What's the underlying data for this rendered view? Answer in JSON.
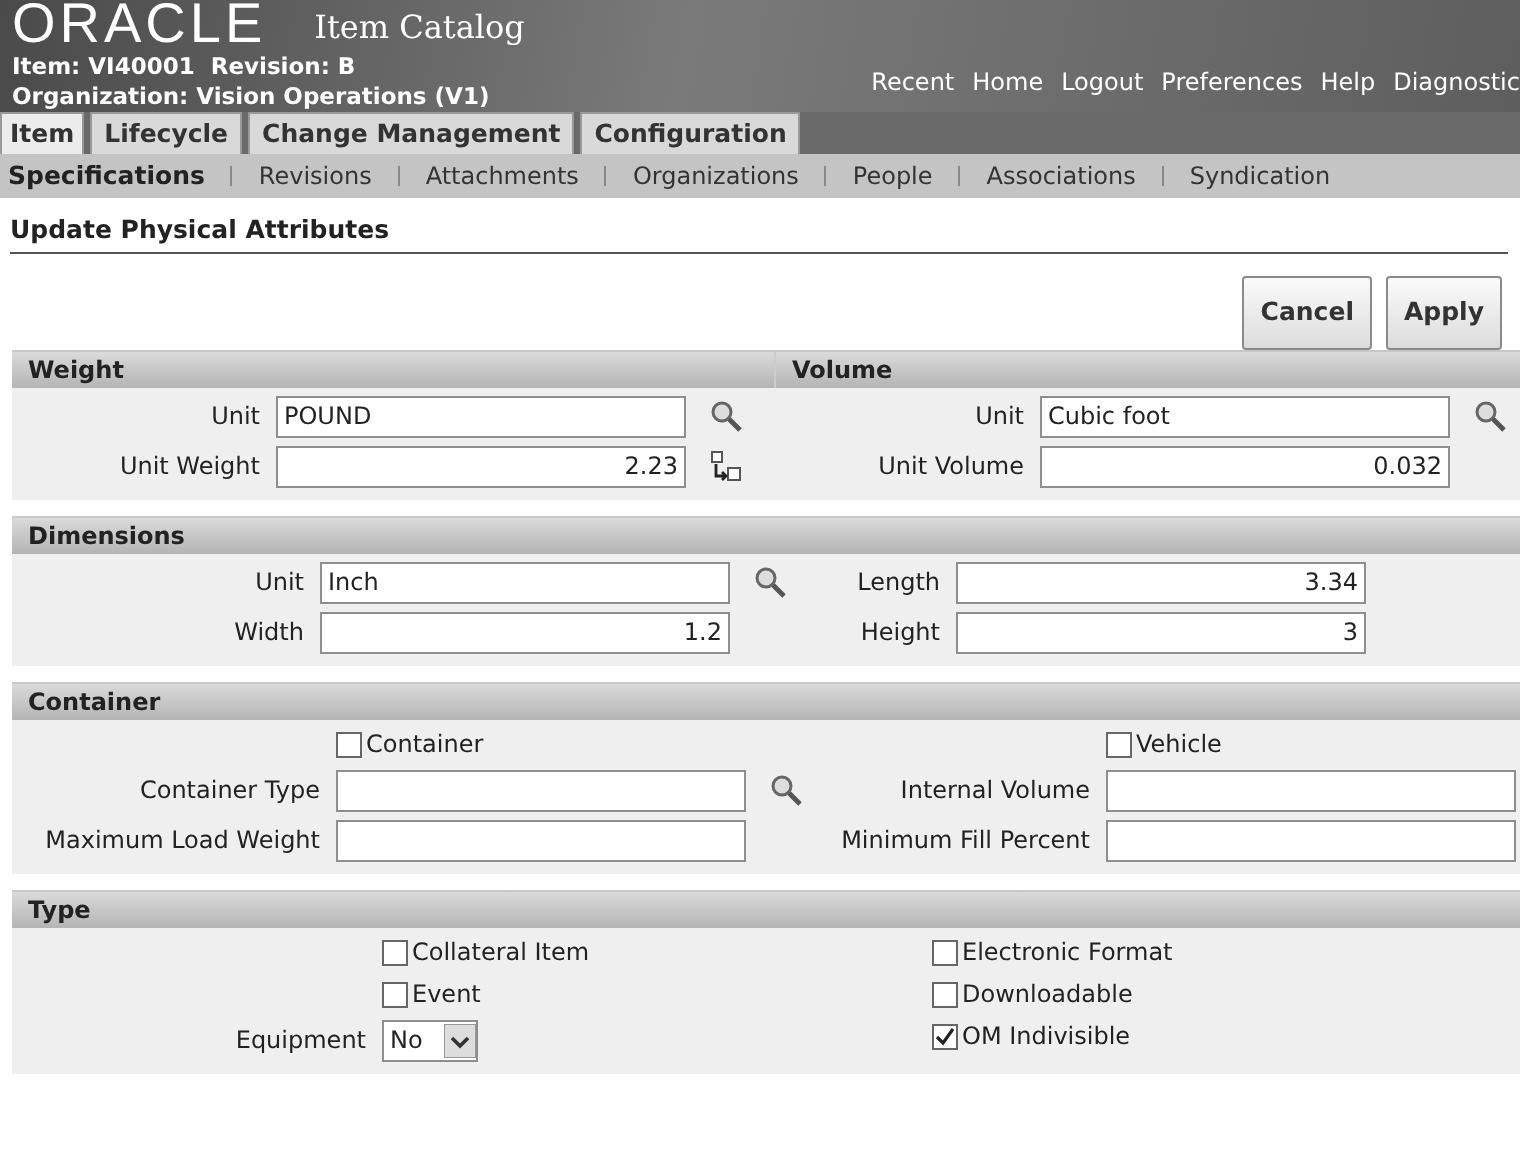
{
  "header": {
    "logo": "ORACLE",
    "app_title": "Item Catalog",
    "item_line": "Item: VI40001  Revision: B",
    "organization_line": "Organization: Vision Operations (V1)",
    "global_links": [
      "Recent",
      "Home",
      "Logout",
      "Preferences",
      "Help",
      "Diagnostic"
    ]
  },
  "tabs": [
    {
      "label": "Item",
      "selected": true
    },
    {
      "label": "Lifecycle",
      "selected": false
    },
    {
      "label": "Change Management",
      "selected": false
    },
    {
      "label": "Configuration",
      "selected": false
    }
  ],
  "subtabs": [
    {
      "label": "Specifications",
      "selected": true
    },
    {
      "label": "Revisions",
      "selected": false
    },
    {
      "label": "Attachments",
      "selected": false
    },
    {
      "label": "Organizations",
      "selected": false
    },
    {
      "label": "People",
      "selected": false
    },
    {
      "label": "Associations",
      "selected": false
    },
    {
      "label": "Syndication",
      "selected": false
    }
  ],
  "page_title": "Update Physical Attributes",
  "buttons": [
    "Cancel",
    "Apply"
  ],
  "sections": [
    {
      "headers": [
        "Weight",
        "Volume"
      ],
      "columns": [
        [
          {
            "kind": "text",
            "label": "Unit",
            "value": "POUND",
            "lookup": true
          },
          {
            "kind": "number",
            "label": "Unit Weight",
            "value": "2.23",
            "convert": true
          }
        ],
        [
          {
            "kind": "text",
            "label": "Unit",
            "value": "Cubic foot",
            "lookup": true
          },
          {
            "kind": "number",
            "label": "Unit Volume",
            "value": "0.032"
          }
        ]
      ]
    },
    {
      "headers": [
        "Dimensions"
      ],
      "columns": [
        [
          {
            "kind": "text",
            "label": "Unit",
            "value": "Inch",
            "lookup": true
          },
          {
            "kind": "number",
            "label": "Width",
            "value": "1.2"
          }
        ],
        [
          {
            "kind": "number",
            "label": "Length",
            "value": "3.34"
          },
          {
            "kind": "number",
            "label": "Height",
            "value": "3"
          }
        ]
      ]
    },
    {
      "headers": [
        "Container"
      ],
      "columns": [
        [
          {
            "kind": "checkbox",
            "label": "Container",
            "checked": false
          },
          {
            "kind": "text",
            "label": "Container Type",
            "lookup": true
          },
          {
            "kind": "text",
            "label": "Maximum Load Weight"
          }
        ],
        [
          {
            "kind": "checkbox",
            "label": "Vehicle",
            "checked": false
          },
          {
            "kind": "text",
            "label": "Internal Volume"
          },
          {
            "kind": "text",
            "label": "Minimum Fill Percent"
          }
        ]
      ]
    },
    {
      "headers": [
        "Type"
      ],
      "columns": [
        [
          {
            "kind": "checkbox",
            "label": "Collateral Item",
            "checked": false
          },
          {
            "kind": "checkbox",
            "label": "Event",
            "checked": false
          },
          {
            "kind": "select",
            "label": "Equipment",
            "value": "No"
          }
        ],
        [
          {
            "kind": "checkbox",
            "label": "Electronic Format",
            "checked": false
          },
          {
            "kind": "checkbox",
            "label": "Downloadable",
            "checked": false
          },
          {
            "kind": "checkbox",
            "label": "OM Indivisible",
            "checked": true
          }
        ]
      ]
    }
  ]
}
